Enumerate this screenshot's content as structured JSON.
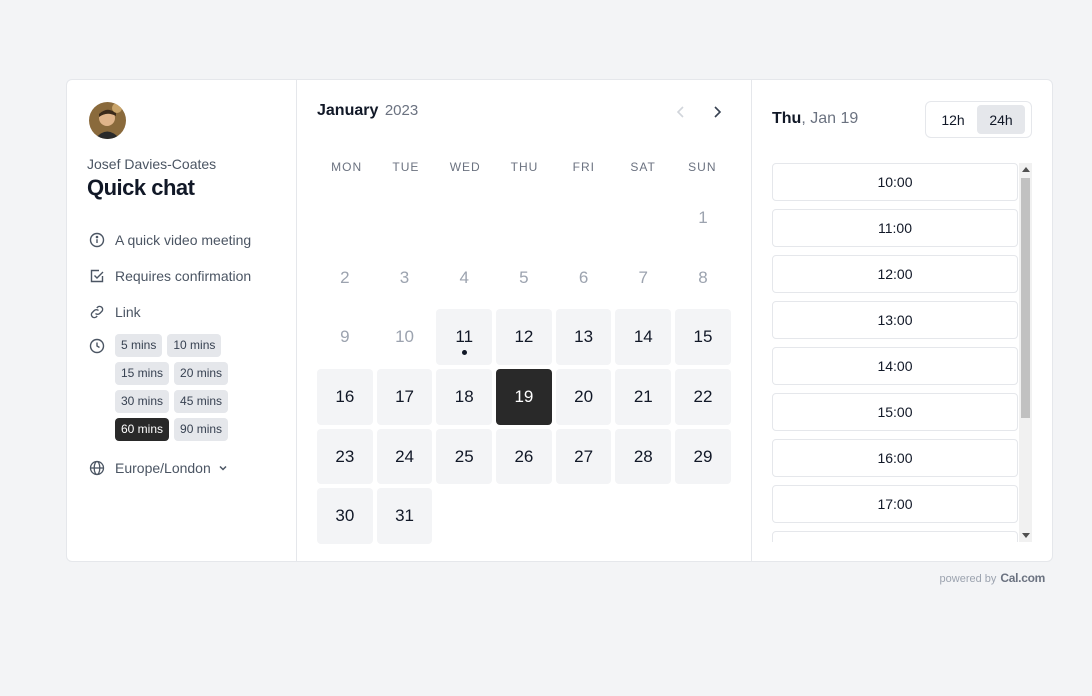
{
  "event": {
    "host_name": "Josef Davies-Coates",
    "title": "Quick chat",
    "description": "A quick video meeting",
    "confirmation": "Requires confirmation",
    "link_label": "Link",
    "timezone": "Europe/London"
  },
  "durations": [
    [
      "5 mins",
      "10 mins"
    ],
    [
      "15 mins",
      "20 mins"
    ],
    [
      "30 mins",
      "45 mins"
    ],
    [
      "60 mins",
      "90 mins"
    ]
  ],
  "selected_duration": "60 mins",
  "calendar": {
    "month": "January",
    "year": "2023",
    "weekdays": [
      "MON",
      "TUE",
      "WED",
      "THU",
      "FRI",
      "SAT",
      "SUN"
    ],
    "leading_blanks": 6,
    "days": [
      {
        "d": "1",
        "avail": false
      },
      {
        "d": "2",
        "avail": false
      },
      {
        "d": "3",
        "avail": false
      },
      {
        "d": "4",
        "avail": false
      },
      {
        "d": "5",
        "avail": false
      },
      {
        "d": "6",
        "avail": false
      },
      {
        "d": "7",
        "avail": false
      },
      {
        "d": "8",
        "avail": false
      },
      {
        "d": "9",
        "avail": false
      },
      {
        "d": "10",
        "avail": false
      },
      {
        "d": "11",
        "avail": true,
        "today": true
      },
      {
        "d": "12",
        "avail": true
      },
      {
        "d": "13",
        "avail": true
      },
      {
        "d": "14",
        "avail": true
      },
      {
        "d": "15",
        "avail": true
      },
      {
        "d": "16",
        "avail": true
      },
      {
        "d": "17",
        "avail": true
      },
      {
        "d": "18",
        "avail": true
      },
      {
        "d": "19",
        "avail": true,
        "selected": true
      },
      {
        "d": "20",
        "avail": true
      },
      {
        "d": "21",
        "avail": true
      },
      {
        "d": "22",
        "avail": true
      },
      {
        "d": "23",
        "avail": true
      },
      {
        "d": "24",
        "avail": true
      },
      {
        "d": "25",
        "avail": true
      },
      {
        "d": "26",
        "avail": true
      },
      {
        "d": "27",
        "avail": true
      },
      {
        "d": "28",
        "avail": true
      },
      {
        "d": "29",
        "avail": true
      },
      {
        "d": "30",
        "avail": true
      },
      {
        "d": "31",
        "avail": true
      }
    ]
  },
  "slots_panel": {
    "weekday": "Thu",
    "date": ", Jan 19",
    "format_12h": "12h",
    "format_24h": "24h",
    "active_format": "24h",
    "times": [
      "10:00",
      "11:00",
      "12:00",
      "13:00",
      "14:00",
      "15:00",
      "16:00",
      "17:00",
      ""
    ]
  },
  "footer": {
    "powered_by": "powered by",
    "brand": "Cal.com"
  }
}
